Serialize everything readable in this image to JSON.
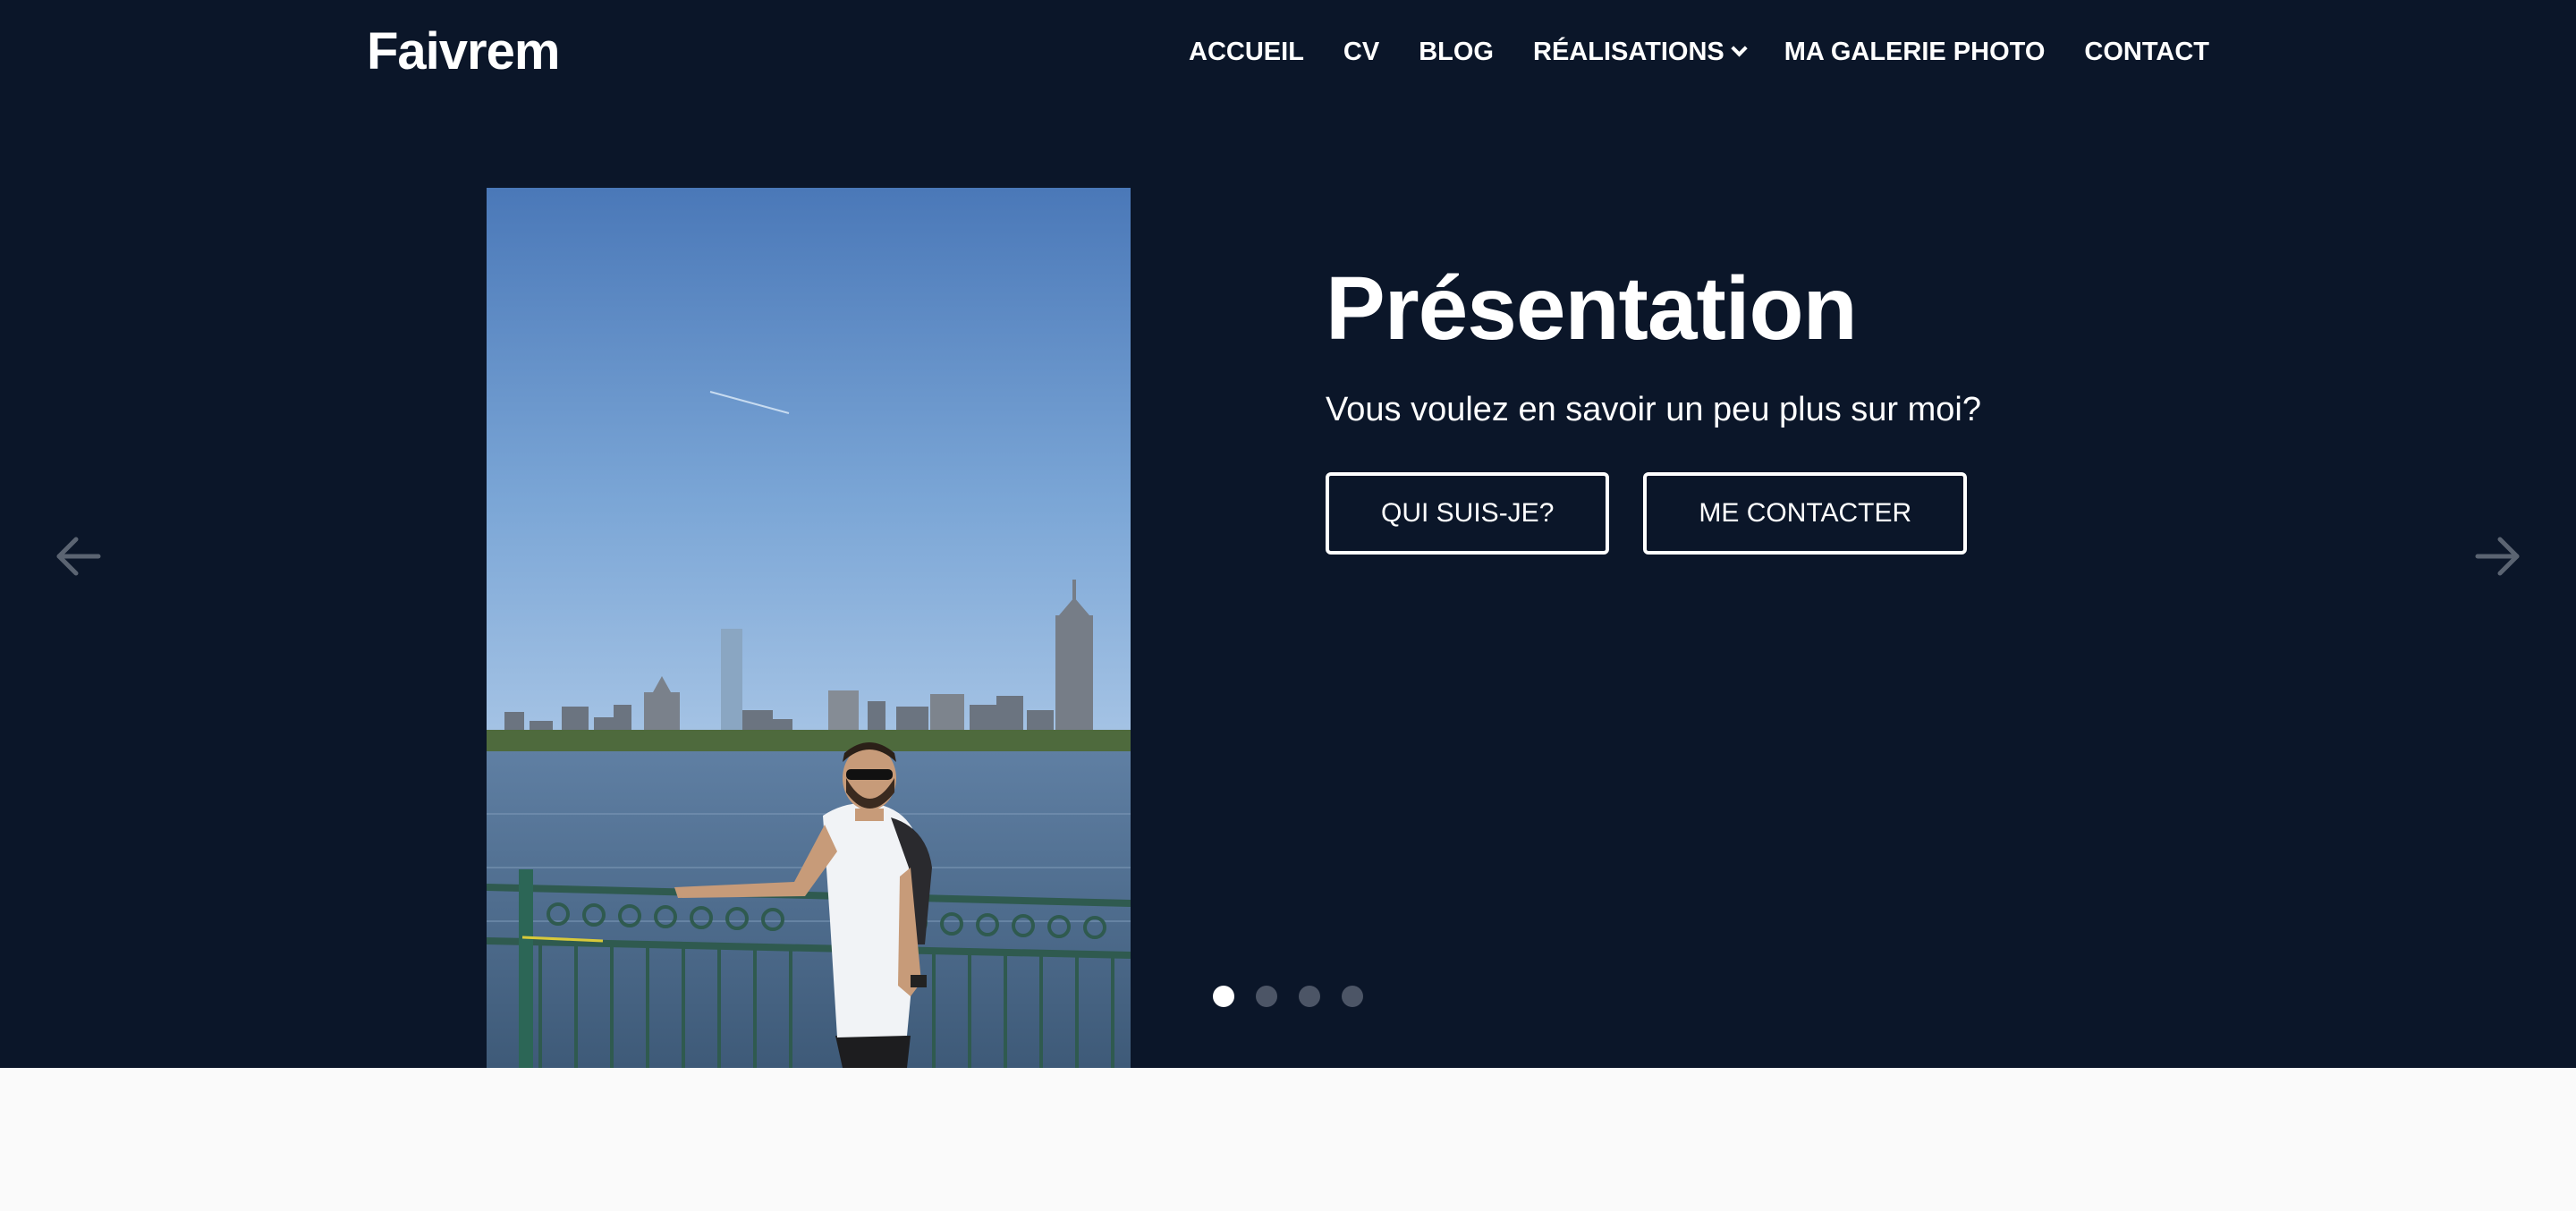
{
  "header": {
    "brand": "Faivrem",
    "nav": [
      {
        "label": "ACCUEIL"
      },
      {
        "label": "CV"
      },
      {
        "label": "BLOG"
      },
      {
        "label": "RÉALISATIONS",
        "has_dropdown": true
      },
      {
        "label": "MA GALERIE PHOTO"
      },
      {
        "label": "CONTACT"
      }
    ]
  },
  "hero": {
    "background_color": "#0b1629",
    "slide": {
      "title": "Présentation",
      "subtitle": "Vous voulez en savoir un peu plus sur moi?",
      "buttons": [
        {
          "label": "QUI SUIS-JE?"
        },
        {
          "label": "ME CONTACTER"
        }
      ]
    },
    "carousel": {
      "prev_icon": "arrow-left-icon",
      "next_icon": "arrow-right-icon",
      "dot_count": 4,
      "active_index": 0
    }
  },
  "colors": {
    "navy": "#0b1629",
    "page_bg": "#fafafa",
    "text": "#ffffff",
    "dot_inactive": "#4c5566"
  }
}
